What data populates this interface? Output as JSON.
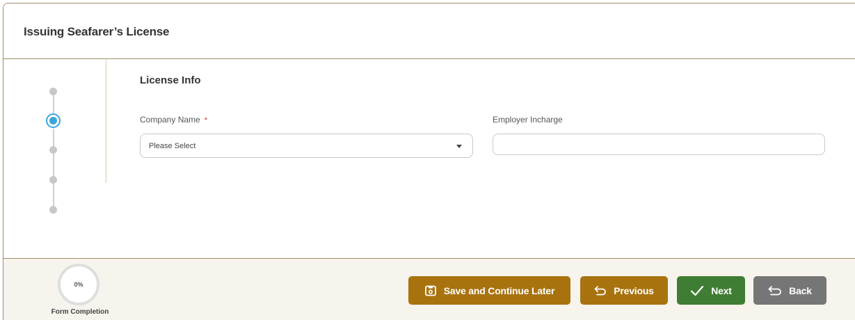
{
  "header": {
    "title": "Issuing Seafarer’s License"
  },
  "stepper": {
    "total_steps": 5,
    "active_step": 2
  },
  "section": {
    "title": "License Info"
  },
  "fields": {
    "company_name": {
      "label": "Company Name",
      "required_mark": "*",
      "value": "Please Select"
    },
    "employer_incharge": {
      "label": "Employer Incharge",
      "value": ""
    }
  },
  "footer": {
    "progress": {
      "value_text": "0%",
      "percent": 0,
      "label": "Form Completion"
    },
    "buttons": {
      "save": "Save and Continue Later",
      "previous": "Previous",
      "next": "Next",
      "back": "Back"
    }
  },
  "colors": {
    "accent_brown": "#a8730f",
    "next_green": "#3e7d33",
    "back_gray": "#767676",
    "active_step_blue": "#3aa6dc",
    "border_tan": "#a08a6a"
  },
  "icons": {
    "save": "save-later-icon",
    "previous": "undo-arrow-icon",
    "next": "checkmark-icon",
    "back": "undo-arrow-icon",
    "dropdown": "caret-down-icon"
  }
}
